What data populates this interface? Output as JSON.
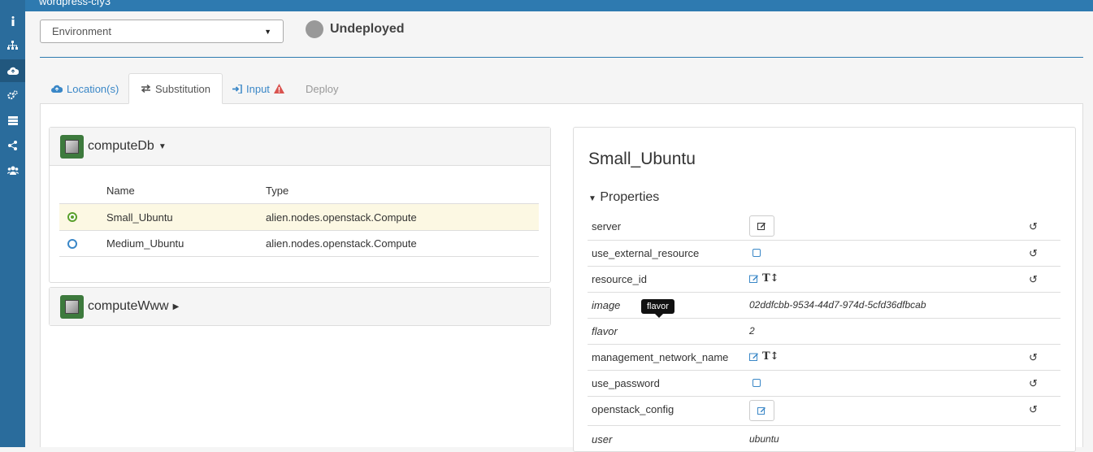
{
  "app": {
    "name": "wordpress-cfy3"
  },
  "sidebar": {
    "items": [
      {
        "icon": "info-icon"
      },
      {
        "icon": "topology-icon"
      },
      {
        "icon": "cloud-upload-icon"
      },
      {
        "icon": "gears-icon"
      },
      {
        "icon": "server-icon"
      },
      {
        "icon": "share-icon"
      },
      {
        "icon": "users-icon"
      }
    ]
  },
  "environment": {
    "selected": "Environment"
  },
  "status": {
    "label": "Undeployed",
    "color": "#999999"
  },
  "tabs": [
    {
      "label": "Location(s)",
      "icon": "cloud-upload-icon"
    },
    {
      "label": "Substitution",
      "icon": "exchange-icon"
    },
    {
      "label": "Input",
      "icon": "sign-in-icon",
      "warning": "warning-icon"
    },
    {
      "label": "Deploy"
    }
  ],
  "nodes": [
    {
      "name": "computeDb",
      "expanded": true,
      "columns": [
        "Name",
        "Type"
      ],
      "rows": [
        {
          "name": "Small_Ubuntu",
          "type": "alien.nodes.openstack.Compute",
          "selected": true
        },
        {
          "name": "Medium_Ubuntu",
          "type": "alien.nodes.openstack.Compute",
          "selected": false
        }
      ]
    },
    {
      "name": "computeWww",
      "expanded": false
    }
  ],
  "detail": {
    "title": "Small_Ubuntu",
    "properties_label": "Properties",
    "properties": [
      {
        "name": "server",
        "kind": "edit-button"
      },
      {
        "name": "use_external_resource",
        "kind": "checkbox"
      },
      {
        "name": "resource_id",
        "kind": "edit-text"
      },
      {
        "name": "image",
        "kind": "value",
        "value": "02ddfcbb-9534-44d7-974d-5cfd36dfbcab"
      },
      {
        "name": "flavor",
        "kind": "value",
        "value": "2"
      },
      {
        "name": "management_network_name",
        "kind": "edit-text"
      },
      {
        "name": "use_password",
        "kind": "checkbox"
      },
      {
        "name": "openstack_config",
        "kind": "edit-button"
      },
      {
        "name": "user",
        "kind": "value",
        "value": "ubuntu"
      }
    ]
  },
  "tooltip": {
    "text": "flavor"
  }
}
